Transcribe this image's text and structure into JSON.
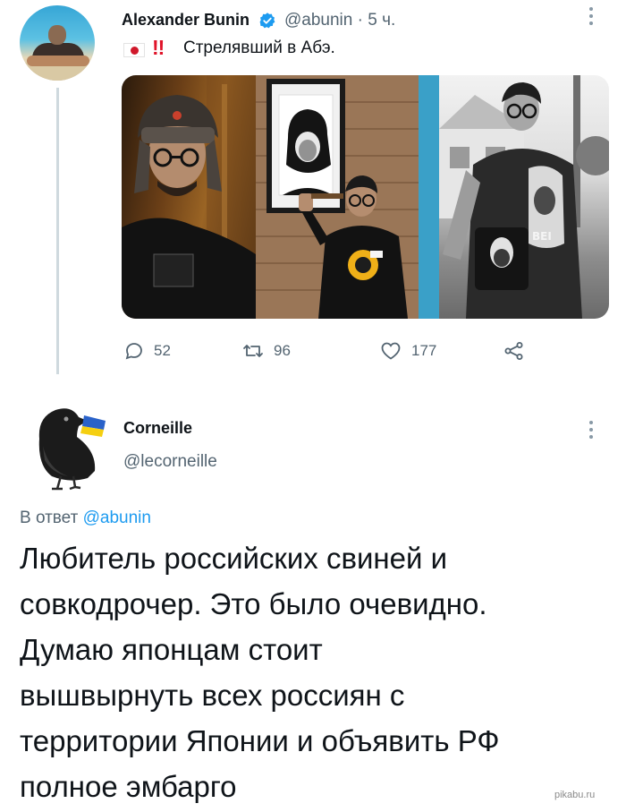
{
  "tweet": {
    "author_name": "Alexander Bunin",
    "handle_time": "@abunin · 5 ч.",
    "verified": true,
    "flag": "japan-flag",
    "exclamation": "!!",
    "text": "Стрелявший в Абэ.",
    "stats": {
      "replies": "52",
      "retweets": "96",
      "likes": "177"
    }
  },
  "reply": {
    "author_name": "Corneille",
    "handle": "@lecorneille",
    "reply_prefix": "В ответ ",
    "reply_to": "@abunin",
    "text_lines": [
      "Любитель российских свиней и",
      "совкодрочер. Это было очевидно.",
      "Думаю японцам стоит",
      "вышвырнуть всех россиян с",
      "территории Японии и объявить РФ",
      "полное эмбарго"
    ]
  },
  "watermark": "pikabu.ru",
  "colors": {
    "accent": "#1d9bf0",
    "secondary_text": "#536471",
    "divider": "#cfd9de",
    "alert_red": "#e0142a"
  }
}
